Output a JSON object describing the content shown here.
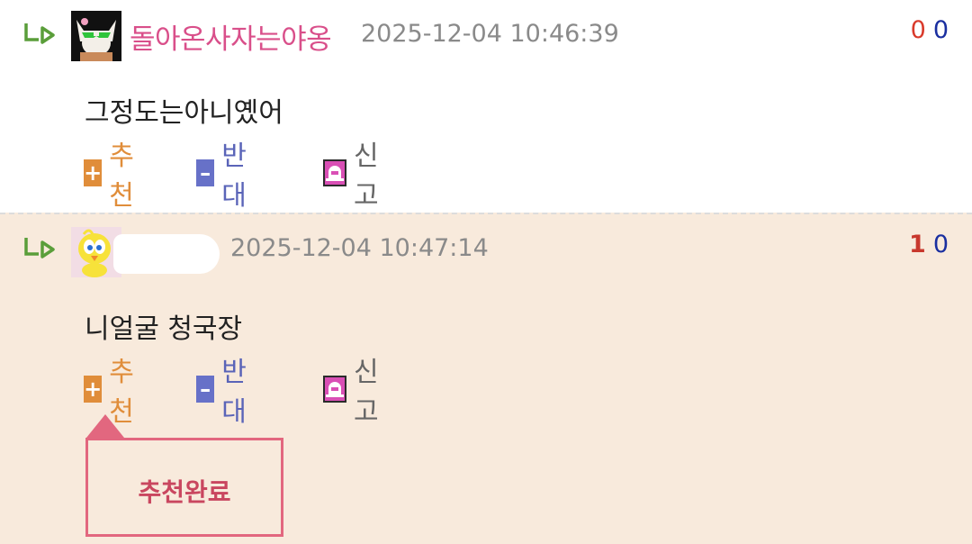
{
  "comments": [
    {
      "author": "돌아온사자는야옹",
      "timestamp": "2025-12-04 10:46:39",
      "votes_up": "0",
      "votes_down": "0",
      "text": "그정도는아니옜어",
      "actions": {
        "recommend": "추천",
        "oppose": "반대",
        "report": "신고"
      }
    },
    {
      "author": "",
      "timestamp": "2025-12-04 10:47:14",
      "votes_up": "1",
      "votes_down": "0",
      "text": "니얼굴 청국장",
      "actions": {
        "recommend": "추천",
        "oppose": "반대",
        "report": "신고"
      },
      "toast": "추천완료"
    }
  ],
  "icons": {
    "reply": "reply-arrow-icon",
    "recommend": "plus-icon",
    "oppose": "minus-icon",
    "report": "siren-icon"
  },
  "colors": {
    "author": "#d94f8a",
    "vote_up": "#d93a2b",
    "vote_down": "#1a2fa0",
    "recommend": "#e08d3a",
    "oppose": "#6771c8",
    "report": "#d94fb5",
    "highlight_bg": "#f8eadc",
    "toast_border": "#e2677f"
  }
}
